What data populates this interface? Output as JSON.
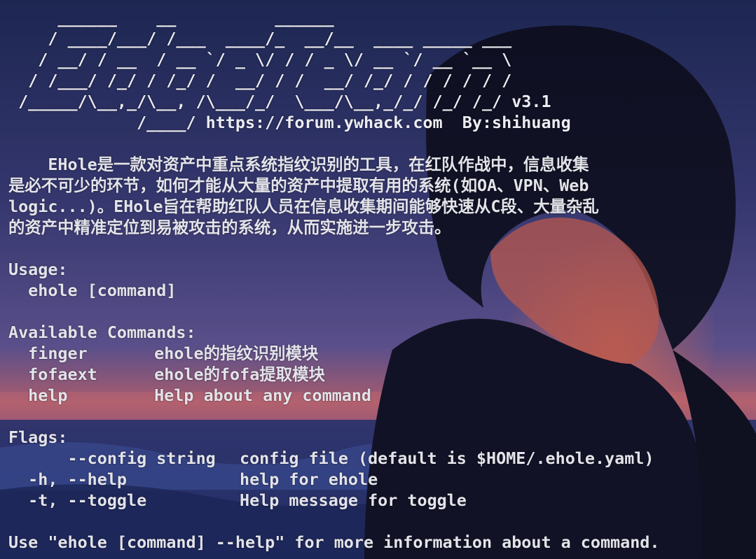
{
  "banner": {
    "ascii_lines": [
      "     ______    __          ______",
      "    / ____/___/ /___  ____/_  __/__  ____ _____ ___",
      "   / __/ / __  / __ `/ _ \\/ / / _ \\/ __ `/ __ `__ \\",
      "  / /___/ /_/ / /_/ /  __/ / /  __/ /_/ / / / / / /",
      " /_____/\\__,_/\\__, /\\___/_/  \\___/\\__,_/_/ /_/ /_/ v3.1",
      "             /____/ https://forum.ywhack.com  By:shihuang"
    ]
  },
  "description": [
    "    EHole是一款对资产中重点系统指纹识别的工具，在红队作战中，信息收集",
    "是必不可少的环节，如何才能从大量的资产中提取有用的系统(如OA、VPN、Web",
    "logic...)。EHole旨在帮助红队人员在信息收集期间能够快速从C段、大量杂乱",
    "的资产中精准定位到易被攻击的系统，从而实施进一步攻击。"
  ],
  "usage": {
    "heading": "Usage:",
    "command": "  ehole [command]"
  },
  "commands": {
    "heading": "Available Commands:",
    "items": [
      {
        "name": "finger",
        "desc": "ehole的指纹识别模块"
      },
      {
        "name": "fofaext",
        "desc": "ehole的fofa提取模块"
      },
      {
        "name": "help",
        "desc": "Help about any command"
      }
    ]
  },
  "flags": {
    "heading": "Flags:",
    "items": [
      {
        "name": "      --config string",
        "desc": "config file (default is $HOME/.ehole.yaml)"
      },
      {
        "name": "  -h, --help",
        "desc": "help for ehole"
      },
      {
        "name": "  -t, --toggle",
        "desc": "Help message for toggle"
      }
    ]
  },
  "footer": "Use \"ehole [command] --help\" for more information about a command.",
  "colors": {
    "text": "#e3e3ea",
    "sky_top": "#1f2a55",
    "sky_mid": "#4d4a86",
    "horizon": "#b05a6a",
    "sea": "#2a3a78"
  }
}
